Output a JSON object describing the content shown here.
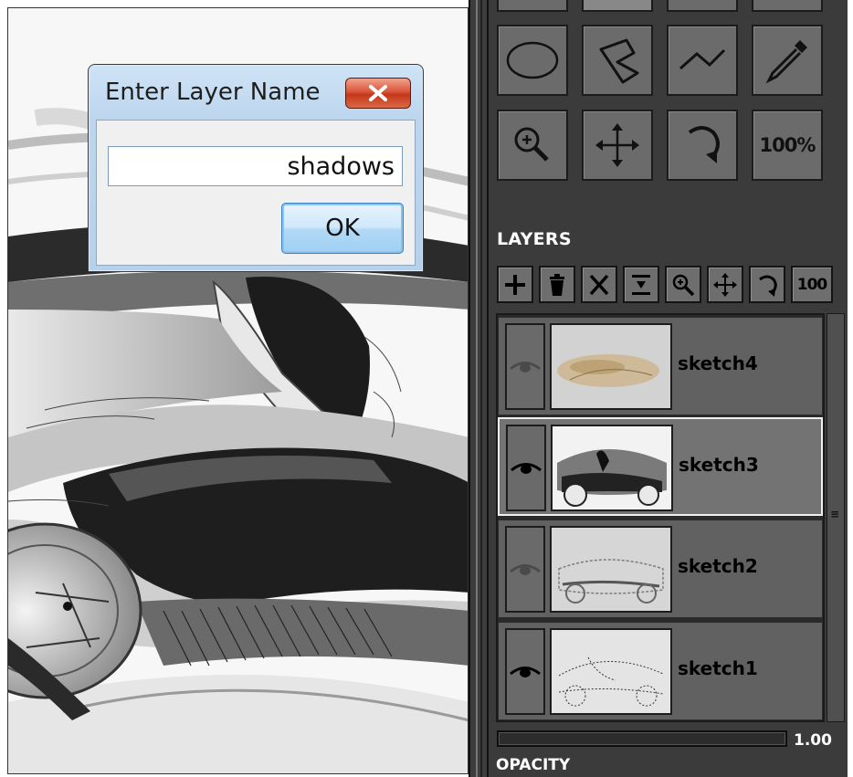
{
  "dialog": {
    "title": "Enter Layer Name",
    "input_value": "shadows",
    "ok_label": "OK"
  },
  "tools": {
    "row1": [
      "ellipse-select-icon",
      "lasso-icon",
      "polyline-icon",
      "eyedropper-icon"
    ],
    "row2": [
      "zoom-icon",
      "move-icon",
      "rotate-icon",
      "100%"
    ]
  },
  "layers": {
    "title": "LAYERS",
    "toolbar": [
      "add-layer-icon",
      "delete-layer-icon",
      "clear-layer-icon",
      "merge-down-icon",
      "zoom-icon",
      "move-icon",
      "rotate-icon",
      "100"
    ],
    "items": [
      {
        "name": "sketch4",
        "visible": false,
        "selected": false
      },
      {
        "name": "sketch3",
        "visible": true,
        "selected": true
      },
      {
        "name": "sketch2",
        "visible": false,
        "selected": false
      },
      {
        "name": "sketch1",
        "visible": true,
        "selected": false
      }
    ]
  },
  "opacity": {
    "label": "OPACITY",
    "value_text": "1.00",
    "value": 1.0
  }
}
